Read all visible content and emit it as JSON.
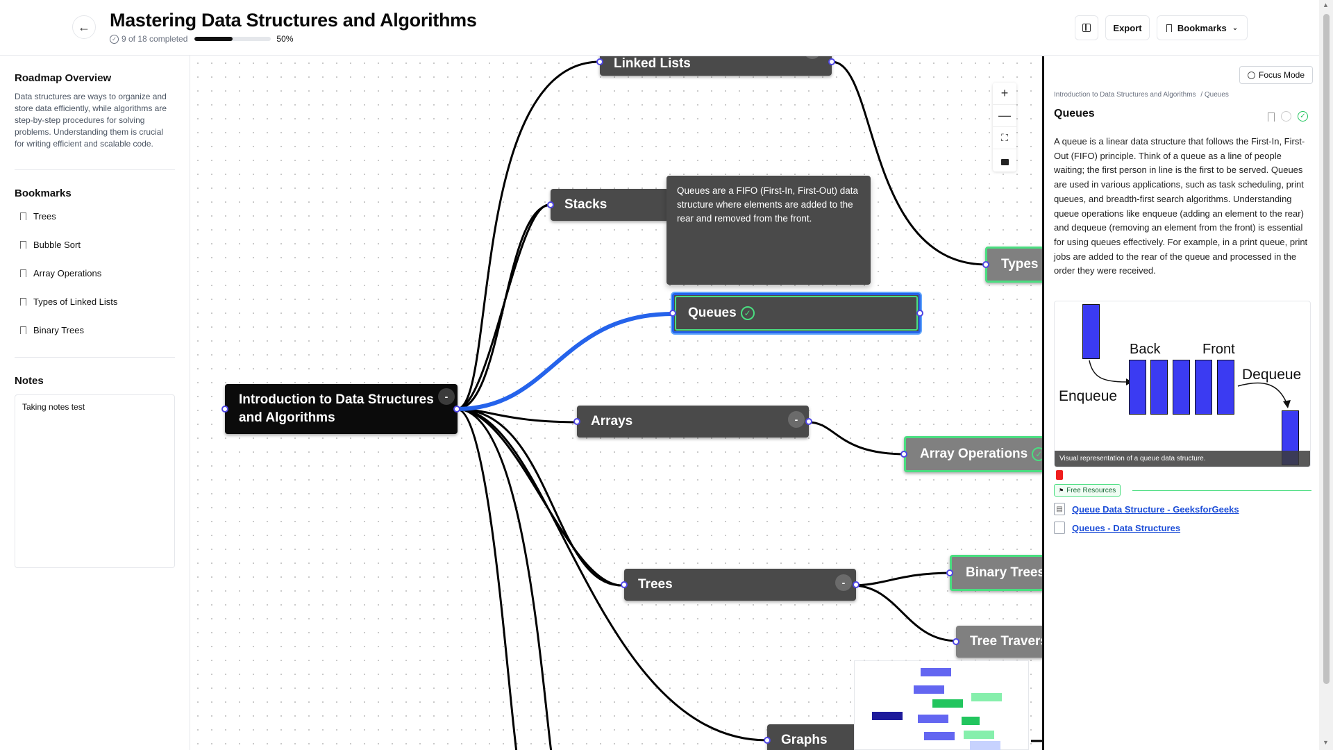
{
  "header": {
    "back_icon": "arrow-left-icon",
    "title": "Mastering Data Structures and Algorithms",
    "progress_text": "9 of 18 completed",
    "progress_value": 0.5,
    "progress_percent": "50%",
    "export_label": "Export",
    "bookmarks_label": "Bookmarks"
  },
  "sidebar": {
    "overview_title": "Roadmap Overview",
    "overview_text": "Data structures are ways to organize and store data efficiently, while algorithms are step-by-step procedures for solving problems. Understanding them is crucial for writing efficient and scalable code.",
    "bookmarks_title": "Bookmarks",
    "bookmarks": [
      "Trees",
      "Bubble Sort",
      "Array Operations",
      "Types of Linked Lists",
      "Binary Trees"
    ],
    "notes_title": "Notes",
    "notes_text": "Taking notes test"
  },
  "canvas": {
    "root": "Introduction to Data Structures and Algorithms",
    "nodes": {
      "linked_lists": "Linked Lists",
      "stacks": "Stacks",
      "queues": "Queues",
      "arrays": "Arrays",
      "trees": "Trees",
      "graphs": "Graphs",
      "types_of_ll": "Types o",
      "array_operations": "Array Operations",
      "binary_trees": "Binary Trees",
      "tree_traversal": "Tree Traversa"
    },
    "collapse_symbol": "-",
    "tooltip": "Queues are a FIFO (First-In, First-Out) data structure where elements are added to the rear and removed from the front."
  },
  "panel": {
    "focus_mode": "Focus Mode",
    "breadcrumb_root": "Introduction to Data Structures and Algorithms",
    "breadcrumb_current": "/ Queues",
    "title": "Queues",
    "body": "A queue is a linear data structure that follows the First-In, First-Out (FIFO) principle. Think of a queue as a line of people waiting; the first person in line is the first to be served. Queues are used in various applications, such as task scheduling, print queues, and breadth-first search algorithms. Understanding queue operations like enqueue (adding an element to the rear) and dequeue (removing an element from the front) is essential for using queues effectively. For example, in a print queue, print jobs are added to the rear of the queue and processed in the order they were received.",
    "figure": {
      "back": "Back",
      "front": "Front",
      "enqueue": "Enqueue",
      "dequeue": "Dequeue",
      "caption": "Visual representation of a queue data structure."
    },
    "resources_tag": "Free Resources",
    "resources": [
      "Queue Data Structure - GeeksforGeeks",
      "Queues - Data Structures"
    ]
  },
  "colors": {
    "accent_blue": "#2563eb",
    "complete_green": "#4ade80",
    "node_dark": "#4a4a4a"
  }
}
